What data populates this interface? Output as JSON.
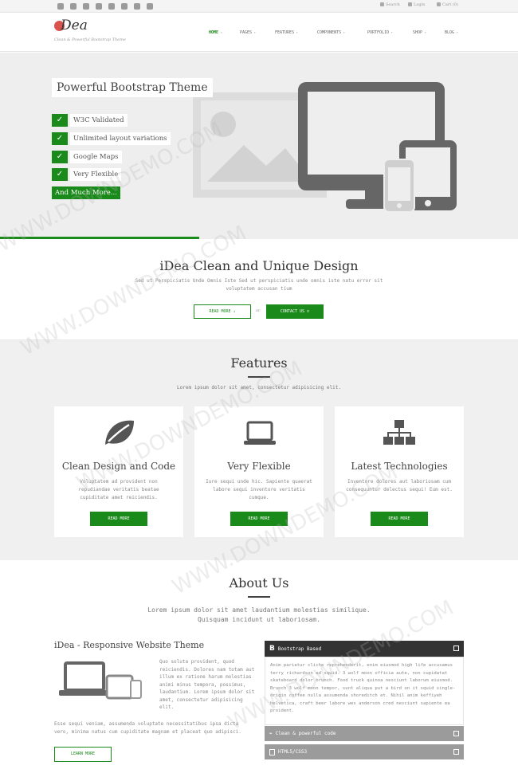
{
  "topbar": {
    "social_icons": [
      "twitter-icon",
      "skype-icon",
      "linkedin-icon",
      "google-plus-icon",
      "youtube-icon",
      "flickr-icon",
      "facebook-icon",
      "pinterest-icon"
    ],
    "search": "Search",
    "login": "Login",
    "cart": "Cart (0)"
  },
  "header": {
    "logo_text": "Dea",
    "tagline": "Clean & Powerful Bootstrap Theme",
    "nav": [
      "HOME",
      "PAGES",
      "FEATURES",
      "COMPONENTS",
      "PORTFOLIO",
      "SHOP",
      "BLOG"
    ]
  },
  "hero": {
    "title": "Powerful Bootstrap Theme",
    "features": [
      "W3C Validated",
      "Unlimited layout variations",
      "Google Maps",
      "Very Flexible"
    ],
    "more": "And Much More..."
  },
  "intro": {
    "title": "iDea Clean and Unique Design",
    "subtitle": "Sed ut Perspiciatis Unde Omnis Iste Sed ut perspiciatis unde omnis iste natu error sit voluptatem accusan tium",
    "read_more": "READ MORE",
    "or": "or",
    "contact": "CONTACT US"
  },
  "features": {
    "title": "Features",
    "subtitle": "Lorem ipsum dolor sit amet, consectetur adipisicing elit.",
    "cards": [
      {
        "icon": "leaf-icon",
        "title": "Clean Design and Code",
        "text": "Voluptatem ad provident non repudiandae veritatis beatae cupiditate amet reiciendis.",
        "button": "READ MORE"
      },
      {
        "icon": "laptop-icon",
        "title": "Very Flexible",
        "text": "Iure sequi unde hic. Sapiente quaerat labore sequi inventore veritatis cumque.",
        "button": "READ MORE"
      },
      {
        "icon": "sitemap-icon",
        "title": "Latest Technologies",
        "text": "Inventore dolores aut laboriosam cum consequuntur delectus sequi! Eum est.",
        "button": "READ MORE"
      }
    ]
  },
  "about": {
    "title": "About Us",
    "subtitle": "Lorem ipsum dolor sit amet laudantium molestias similique. Quisquam incidunt ut laboriosam.",
    "heading": "iDea - Responsive Website Theme",
    "column_text": "Quo soluta provident, quod reiciendis. Dolores nam totam aut illum ex ratione harum molestias animi minus tempora, possimus, laudantium. Lorem ipsum dolor sit amet, consectetur adipisicing elit.",
    "paragraph": "Esse sequi veniam, assumenda voluptate necessitatibus ipsa dicta vero, minima natus cum cupiditate magnam et placeat quo adipisci.",
    "button": "LEARN MORE",
    "accordion": [
      {
        "label": "Bootstrap Based",
        "icon": "bootstrap-icon",
        "open": true,
        "body": "Anim pariatur cliche reprehenderit, enim eiusmod high life accusamus terry richardson ad squid. 3 wolf moon officia aute, non cupidatat skateboard dolor brunch. Food truck quinoa nesciunt laborum eiusmod. Brunch 3 wolf moon tempor, sunt aliqua put a bird on it squid single-origin coffee nulla assumenda shoreditch et. Nihil anim keffiyeh helvetica, craft beer labore wes anderson cred nesciunt sapiente ea proident."
      },
      {
        "label": "Clean & powerful code",
        "icon": "leaf-icon",
        "open": false
      },
      {
        "label": "HTML5/CSS3",
        "icon": "html5-icon",
        "open": false
      }
    ]
  },
  "watermark": "WWW.DOWNDEMO.COM",
  "colors": {
    "accent": "#1a8a1a",
    "logo": "#d9534f",
    "dark": "#333333"
  }
}
